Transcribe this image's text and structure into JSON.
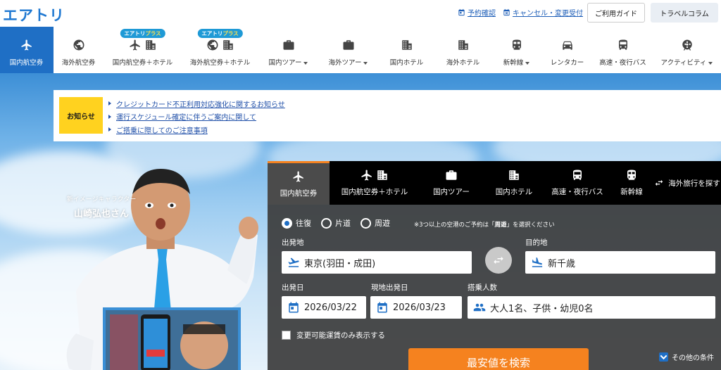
{
  "brand": {
    "logo": "エアトリ"
  },
  "header": {
    "links": [
      {
        "label": "予約確認",
        "icon": "calendar-icon"
      },
      {
        "label": "キャンセル・変更受付",
        "icon": "calendar-x-icon"
      }
    ],
    "guide_label": "ご利用ガイド",
    "column_label": "トラベルコラム"
  },
  "nav": {
    "plus_badge": {
      "prefix": "エアトリ",
      "suffix": "プラス"
    },
    "items": [
      {
        "label": "国内航空券",
        "active": true
      },
      {
        "label": "海外航空券"
      },
      {
        "label": "国内航空券＋ホテル"
      },
      {
        "label": "海外航空券＋ホテル"
      },
      {
        "label": "国内ツアー"
      },
      {
        "label": "海外ツアー"
      },
      {
        "label": "国内ホテル"
      },
      {
        "label": "海外ホテル"
      },
      {
        "label": "新幹線"
      },
      {
        "label": "レンタカー"
      },
      {
        "label": "高速・夜行バス"
      },
      {
        "label": "アクティビティ"
      }
    ]
  },
  "notice": {
    "badge": "お知らせ",
    "items": [
      "クレジットカード不正利用対応強化に関するお知らせ",
      "運行スケジュール確定に伴うご案内に関して",
      "ご搭乗に際してのご注意事項"
    ]
  },
  "character": {
    "sub": "新イメージキャラクター",
    "name": "山崎弘也さん"
  },
  "search": {
    "tabs": [
      {
        "label": "国内航空券",
        "active": true
      },
      {
        "label": "国内航空券＋ホテル"
      },
      {
        "label": "国内ツアー"
      },
      {
        "label": "国内ホテル"
      },
      {
        "label": "高速・夜行バス"
      },
      {
        "label": "新幹線"
      }
    ],
    "overseas_label": "海外旅行を探す",
    "trip_types": [
      {
        "label": "往復",
        "selected": true
      },
      {
        "label": "片道",
        "selected": false
      },
      {
        "label": "周遊",
        "selected": false
      }
    ],
    "trip_note_pre": "※3つ以上の空港のご予約は「",
    "trip_note_bold": "周遊",
    "trip_note_post": "」を選択ください",
    "from_label": "出発地",
    "from_value": "東京(羽田・成田)",
    "to_label": "目的地",
    "to_value": "新千歳",
    "depart_label": "出発日",
    "depart_value": "2026/03/22",
    "return_label": "現地出発日",
    "return_value": "2026/03/23",
    "pax_label": "搭乗人数",
    "pax_value": "大人1名、子供・幼児0名",
    "changeable_label": "変更可能運賃のみ表示する",
    "submit_label": "最安値を検索",
    "other_label": "その他の条件"
  },
  "colors": {
    "brand_blue": "#1f6fc5",
    "accent_orange": "#f5821f",
    "notice_yellow": "#ffd21f"
  }
}
